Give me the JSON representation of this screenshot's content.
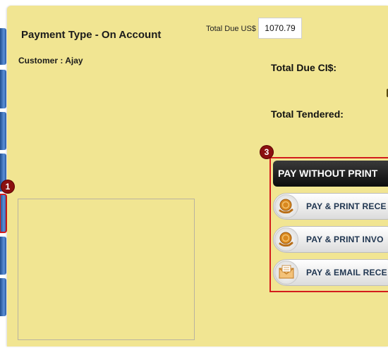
{
  "dialog": {
    "title": "Payment Type - On Account",
    "customer": "Customer : Ajay",
    "total_due_us_label": "Total Due US$",
    "total_due_us_value": "1070.79",
    "total_due_ci_label": "Total Due CI$:",
    "total_tendered_label": "Total Tendered:"
  },
  "buttons": {
    "pay_without_print": "PAY WITHOUT PRINT",
    "pay_print_receipt": "PAY & PRINT RECE",
    "pay_print_invoice": "PAY & PRINT INVO",
    "pay_email_receipt": "PAY & EMAIL RECE"
  },
  "badges": {
    "one": "1",
    "three": "3"
  },
  "icons": {
    "pay_print_receipt": "coin-hand-icon",
    "pay_print_invoice": "coin-hand-icon",
    "pay_email_receipt": "envelope-icon"
  },
  "colors": {
    "panel_background": "#f1e592",
    "highlight_border": "#d31c1c",
    "badge": "#8b1010",
    "button_text": "#1f3550"
  }
}
